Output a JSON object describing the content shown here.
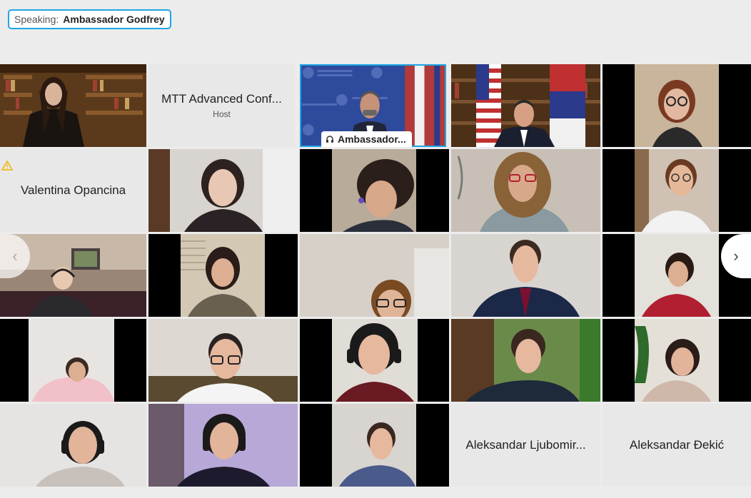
{
  "speaking": {
    "label": "Speaking:",
    "name": "Ambassador Godfrey"
  },
  "tiles": {
    "host": {
      "name": "MTT Advanced Conf...",
      "role": "Host"
    },
    "ambassador": {
      "nametag": "Ambassador..."
    },
    "valentina": {
      "name": "Valentina Opancina"
    },
    "ljubomir": {
      "name": "Aleksandar Ljubomir..."
    },
    "dekic": {
      "name": "Aleksandar Đekić"
    }
  },
  "nav": {
    "prev": "‹",
    "next": "›"
  },
  "colors": {
    "accent": "#1ea6e6",
    "tile_bg": "#e8e8e8",
    "warning": "#f0b400"
  }
}
